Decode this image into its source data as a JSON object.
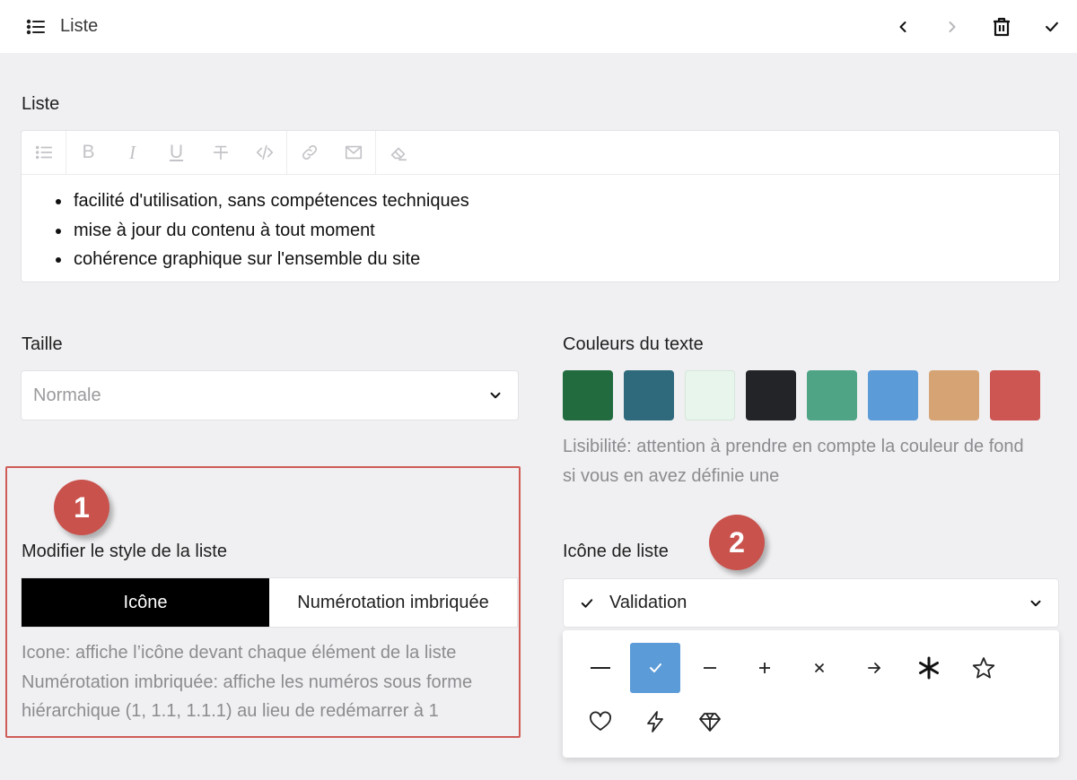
{
  "topbar": {
    "title": "Liste",
    "icons": [
      "list-icon",
      "chevron-left-icon",
      "chevron-right-icon",
      "trash-icon",
      "check-icon"
    ]
  },
  "editor": {
    "label": "Liste",
    "toolbar_icons": [
      "bullet-list-icon",
      "bold-icon",
      "italic-icon",
      "underline-icon",
      "strikethrough-icon",
      "code-icon",
      "link-icon",
      "mail-icon",
      "eraser-icon"
    ],
    "bold_glyph": "B",
    "italic_glyph": "I",
    "underline_glyph": "U",
    "items": [
      "facilité d'utilisation, sans compétences techniques",
      "mise à jour du contenu à tout moment",
      "cohérence graphique sur l'ensemble du site"
    ]
  },
  "size": {
    "label": "Taille",
    "value": "Normale"
  },
  "colors": {
    "label": "Couleurs du texte",
    "swatches": [
      "#216b3f",
      "#2f6a7c",
      "#e8f5ec",
      "#222428",
      "#50a486",
      "#5b9bd8",
      "#d6a474",
      "#cd5652"
    ],
    "help_line1": "Lisibilité: attention à prendre en compte la couleur de fond",
    "help_line2": "si vous en avez définie une"
  },
  "annotations": {
    "badge1": "1",
    "badge2": "2",
    "badge_color": "#c9524d",
    "box_color": "#cf5b57"
  },
  "list_style": {
    "label": "Modifier le style de la liste",
    "options": [
      "Icône",
      "Numérotation imbriquée"
    ],
    "selected": "Icône",
    "help_line1": "Icone: affiche l’icône devant chaque élément de la liste",
    "help_line2": "Numérotation imbriquée: affiche les numéros sous forme",
    "help_line3": "hiérarchique (1, 1.1, 1.1.1) au lieu de redémarrer à 1"
  },
  "list_icon": {
    "label": "Icône de liste",
    "value": "Validation",
    "options": [
      "em-dash-icon",
      "check-icon",
      "minus-icon",
      "plus-icon",
      "times-icon",
      "arrow-right-icon",
      "asterisk-icon",
      "star-icon",
      "heart-icon",
      "lightning-icon",
      "diamond-icon"
    ],
    "selected": "check-icon",
    "accent": "#5b9bd8"
  }
}
